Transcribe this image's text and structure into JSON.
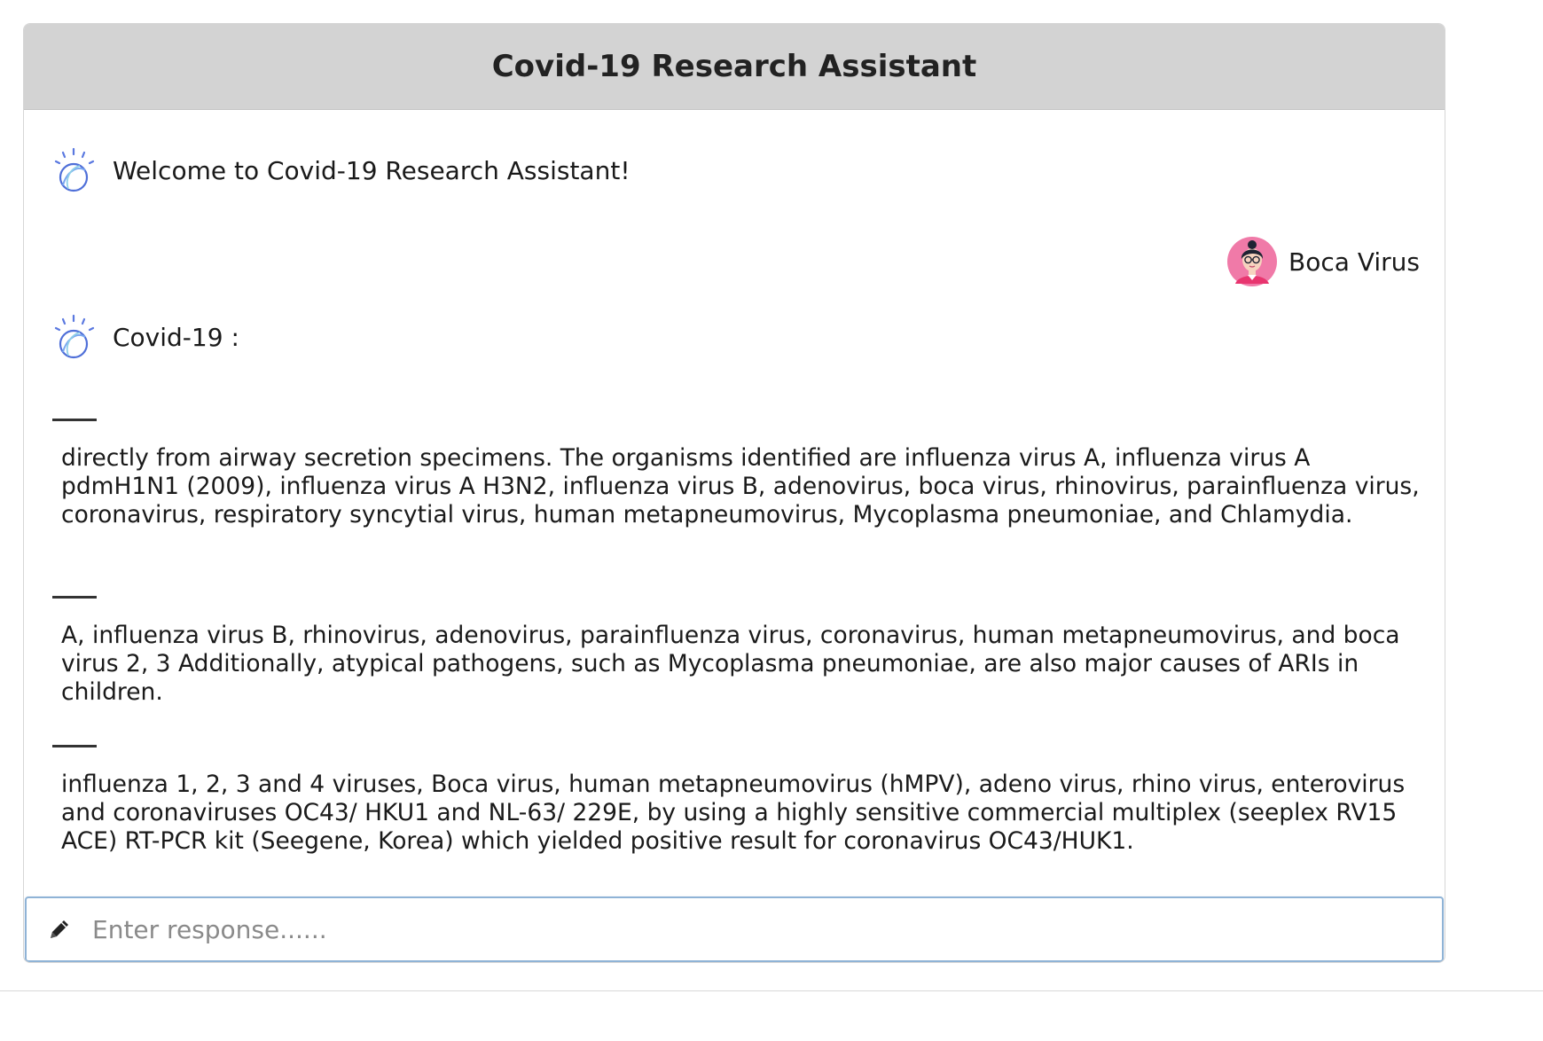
{
  "header": {
    "title": "Covid-19 Research Assistant"
  },
  "messages": {
    "welcome": "Welcome to Covid-19 Research Assistant!",
    "user_query": "Boca Virus",
    "bot_reply_label": "Covid-19 :",
    "results": [
      "directly from airway secretion specimens. The organisms identified are influenza virus A, influenza virus A pdmH1N1 (2009), influenza virus A H3N2, influenza virus B, adenovirus, boca virus, rhinovirus, parainfluenza virus, coronavirus, respiratory syncytial virus, human metapneumovirus, Mycoplasma pneumoniae, and Chlamydia.",
      "A, influenza virus B, rhinovirus, adenovirus, parainfluenza virus, coronavirus, human metapneumovirus, and boca virus 2, 3 Additionally, atypical pathogens, such as Mycoplasma pneumoniae, are also major causes of ARIs in children.",
      "influenza 1, 2, 3 and 4 viruses, Boca virus, human metapneumovirus (hMPV), adeno virus, rhino virus, enterovirus and coronaviruses OC43/ HKU1 and NL-63/ 229E, by using a highly sensitive commercial multiplex (seeplex RV15 ACE) RT-PCR kit (Seegene, Korea) which yielded positive result for coronavirus OC43/HUK1."
    ]
  },
  "input": {
    "placeholder": "Enter response......",
    "value": ""
  },
  "icons": {
    "bot_avatar": "watson-logo-icon",
    "user_avatar": "user-avatar-icon",
    "input_icon": "pencil-icon"
  },
  "colors": {
    "header_bg": "#d3d3d3",
    "input_border": "#8fb3d6",
    "bot_logo": "#4f6fd8",
    "user_avatar_bg": "#f07aa8"
  }
}
